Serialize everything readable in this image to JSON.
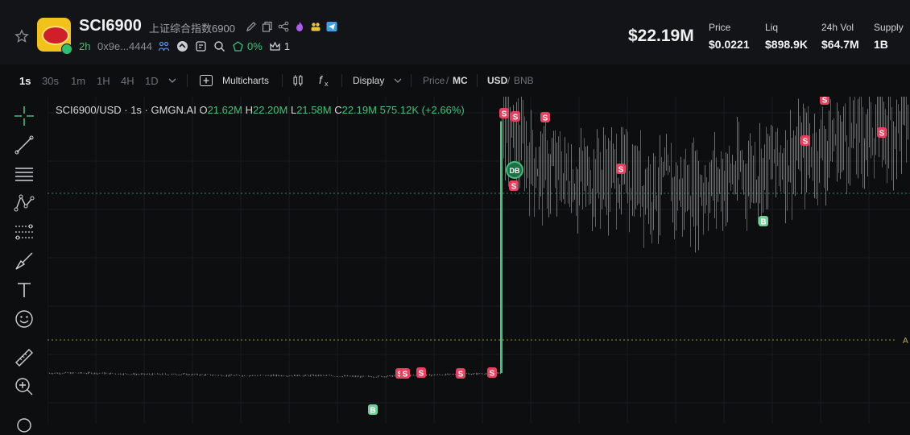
{
  "token": {
    "symbol": "SCI6900",
    "name_zh": "上证综合指数6900",
    "age": "2h",
    "address": "0x9e...4444",
    "holders_pct": "0%",
    "count": "1"
  },
  "stats": {
    "market_cap": "$22.19M",
    "price_label": "Price",
    "price_value": "$0.0221",
    "liq_label": "Liq",
    "liq_value": "$898.9K",
    "vol_label": "24h Vol",
    "vol_value": "$64.7M",
    "supply_label": "Supply",
    "supply_value": "1B"
  },
  "toolbar": {
    "timeframes": [
      "1s",
      "30s",
      "1m",
      "1H",
      "4H",
      "1D"
    ],
    "active_timeframe": "1s",
    "multicharts_label": "Multicharts",
    "display_label": "Display",
    "price_label": "Price",
    "mc_label": "MC",
    "usd_label": "USD",
    "bnb_label": "BNB",
    "slash": "/"
  },
  "legend": {
    "pair": "SCI6900/USD · 1s · GMGN.AI",
    "o_label": "O",
    "o_value": "21.62M",
    "h_label": "H",
    "h_value": "22.20M",
    "l_label": "L",
    "l_value": "21.58M",
    "c_label": "C",
    "c_value": "22.19M",
    "change": "575.12K (+2.66%)"
  },
  "markers": {
    "sell": "S",
    "buy": "B",
    "db": "DB",
    "axis_tag": "A"
  },
  "colors": {
    "up": "#3ec27a",
    "down": "#e8415f",
    "accent_green": "#3ec27a",
    "price_line": "#3ec27a",
    "avg_line": "#c8b030"
  },
  "chart_data": {
    "type": "candlestick",
    "series_values_mc_millions": [
      1.5,
      1.5,
      1.4,
      1.4,
      1.3,
      1.3,
      1.3,
      1.2,
      1.3,
      1.4,
      1.5,
      22.0,
      18.5,
      17.5,
      18.0,
      17.0,
      16.5,
      17.5,
      18.5,
      19.5,
      20.5,
      21.5,
      22.19
    ],
    "last_close": "22.19M",
    "trade_markers": [
      {
        "side": "S",
        "count": 12
      },
      {
        "side": "B",
        "count": 2
      }
    ]
  }
}
